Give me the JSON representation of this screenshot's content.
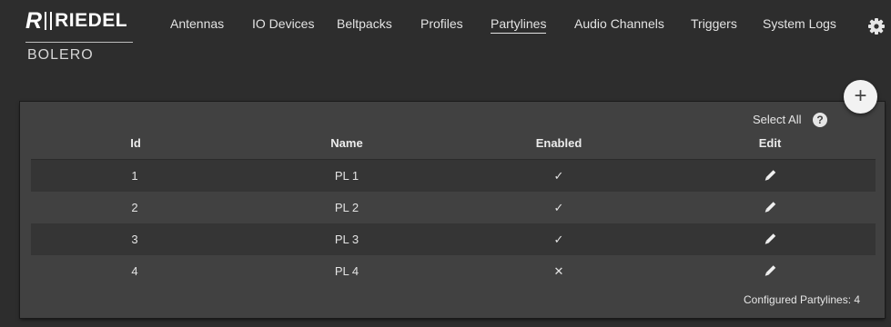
{
  "brand": {
    "name": "RIEDEL",
    "mark": "R",
    "product": "BOLERO"
  },
  "nav": {
    "items": [
      {
        "label": "Antennas",
        "active": false
      },
      {
        "label": "IO Devices",
        "active": false
      },
      {
        "label": "Beltpacks",
        "active": false
      },
      {
        "label": "Profiles",
        "active": false
      },
      {
        "label": "Partylines",
        "active": true
      },
      {
        "label": "Audio Channels",
        "active": false
      },
      {
        "label": "Triggers",
        "active": false
      },
      {
        "label": "System Logs",
        "active": false
      }
    ],
    "settings_icon": "gear-icon"
  },
  "toolbar": {
    "add_label": "+",
    "select_all_label": "Select All",
    "help_label": "?"
  },
  "table": {
    "columns": [
      "Id",
      "Name",
      "Enabled",
      "Edit"
    ],
    "rows": [
      {
        "id": "1",
        "name": "PL 1",
        "enabled": true
      },
      {
        "id": "2",
        "name": "PL 2",
        "enabled": true
      },
      {
        "id": "3",
        "name": "PL 3",
        "enabled": true
      },
      {
        "id": "4",
        "name": "PL 4",
        "enabled": false
      }
    ],
    "enabled_true_symbol": "✓",
    "enabled_false_symbol": "✕",
    "edit_icon": "pencil-icon"
  },
  "footer": {
    "configured_text": "Configured Partylines: 4"
  },
  "colors": {
    "background": "#2d2d2d",
    "panel": "#414141",
    "row_alt": "#353535",
    "text": "#e6e6e6"
  }
}
